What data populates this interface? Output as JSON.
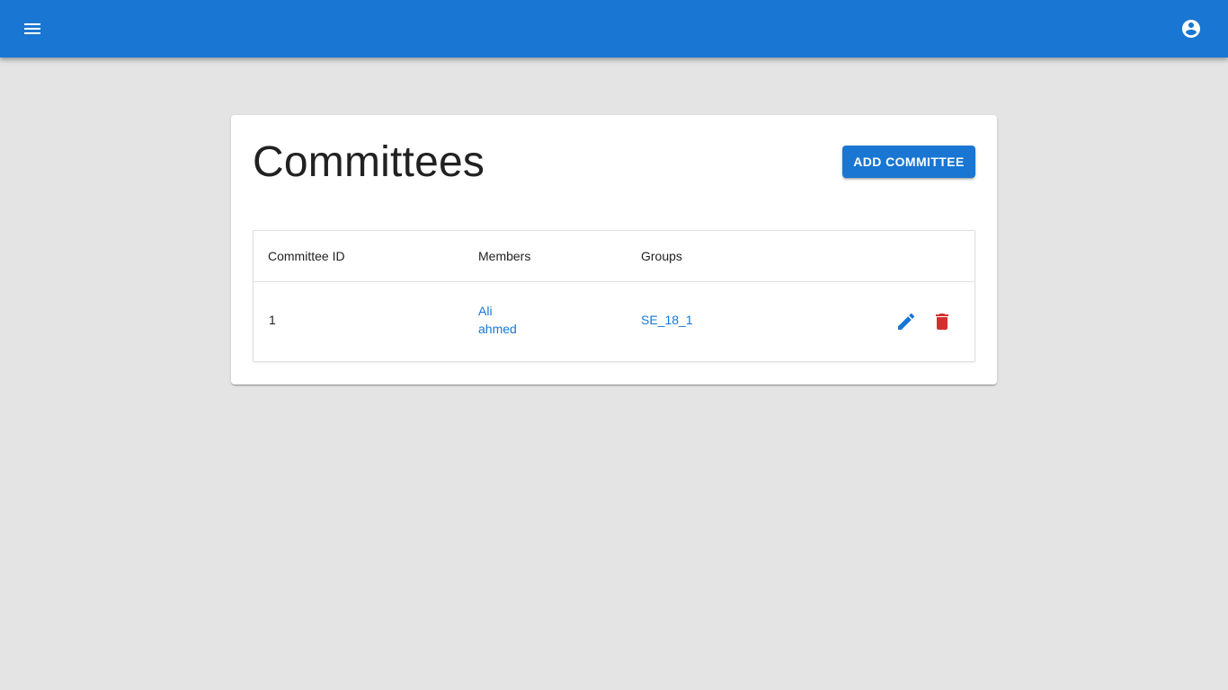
{
  "appbar": {
    "menu_icon": "menu-icon",
    "account_icon": "account-circle-icon",
    "color": "#1976d2"
  },
  "page": {
    "title": "Committees",
    "add_button_label": "ADD COMMITTEE"
  },
  "table": {
    "columns": [
      "Committee ID",
      "Members",
      "Groups"
    ],
    "rows": [
      {
        "id": "1",
        "members": [
          "Ali",
          "ahmed"
        ],
        "groups": [
          "SE_18_1"
        ],
        "actions": [
          "edit-icon",
          "delete-icon"
        ]
      }
    ]
  },
  "colors": {
    "primary": "#1976d2",
    "danger": "#d32f2f",
    "background": "#e4e4e4"
  }
}
